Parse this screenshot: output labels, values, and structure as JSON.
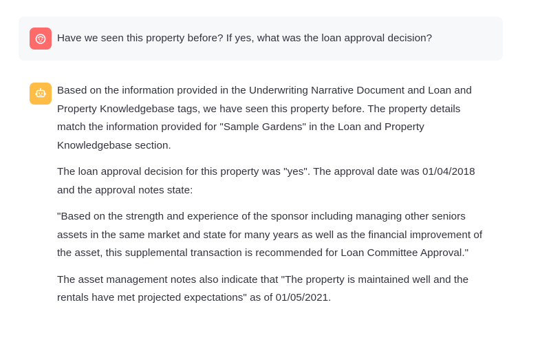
{
  "chat": {
    "user_message": {
      "avatar_icon": "user-face-icon",
      "avatar_color": "#ff6b6b",
      "text": "Have we seen this property before? If yes, what was the loan approval decision?"
    },
    "assistant_message": {
      "avatar_icon": "robot-icon",
      "avatar_color": "#ffbd45",
      "paragraphs": [
        "Based on the information provided in the Underwriting Narrative Document and Loan and Property Knowledgebase tags, we have seen this property before. The property details match the information provided for \"Sample Gardens\" in the Loan and Property Knowledgebase section.",
        "The loan approval decision for this property was \"yes\". The approval date was 01/04/2018 and the approval notes state:",
        "\"Based on the strength and experience of the sponsor including managing other seniors assets in the same market and state for many years as well as the financial improvement of the asset, this supplemental transaction is recommended for Loan Committee Approval.\"",
        "The asset management notes also indicate that \"The property is maintained well and the rentals have met projected expectations\" as of 01/05/2021."
      ]
    }
  }
}
